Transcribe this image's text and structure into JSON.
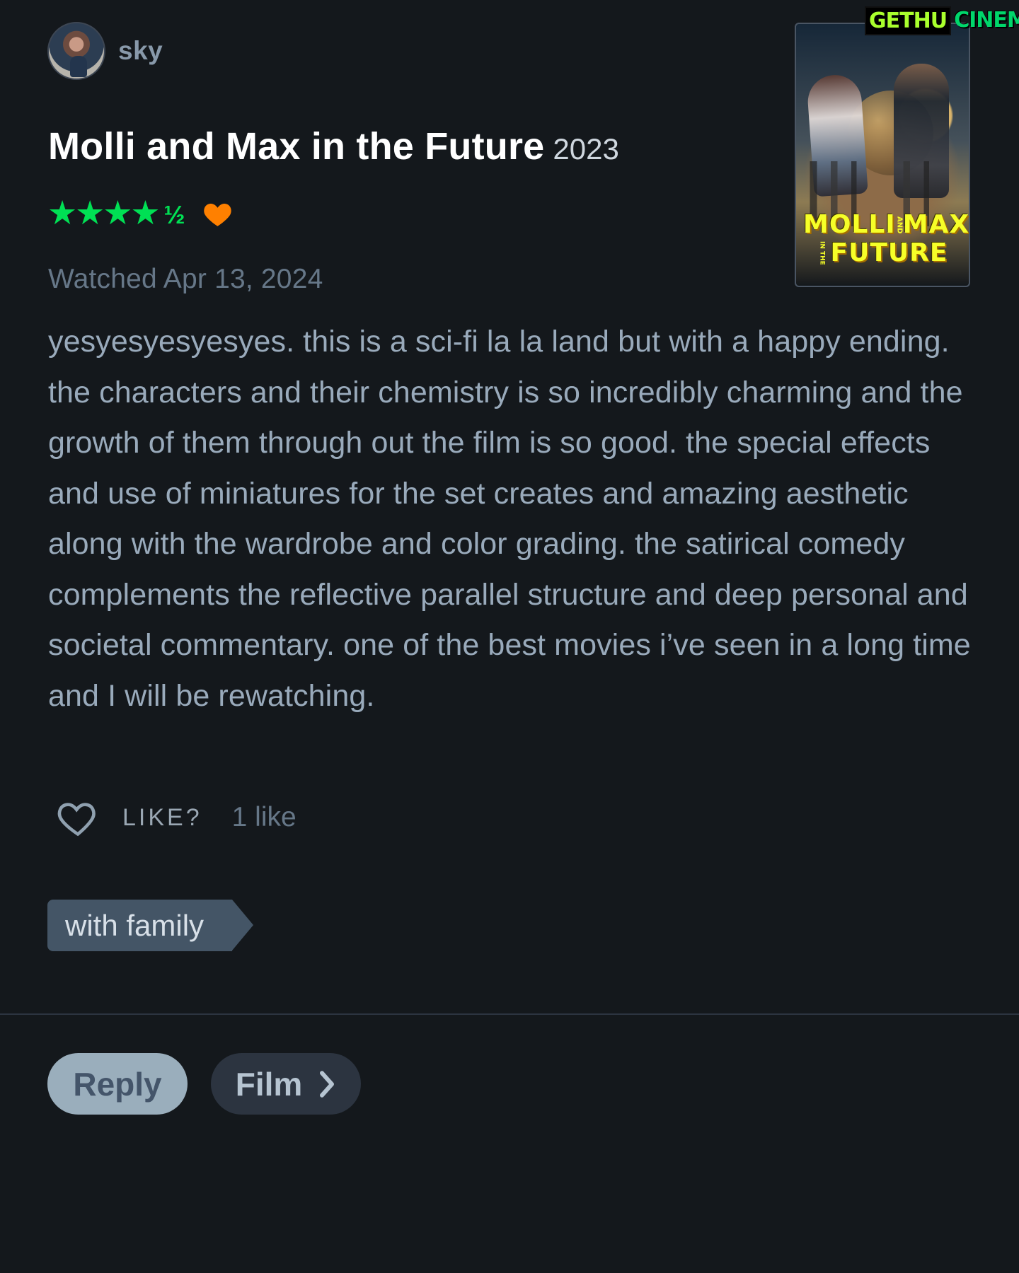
{
  "user": {
    "name": "sky"
  },
  "film": {
    "title": "Molli and Max in the Future",
    "year": "2023",
    "rating_stars": "★★★★",
    "rating_half": "½",
    "rating_value": 4.5,
    "liked": true
  },
  "watched": {
    "text": "Watched Apr 13, 2024"
  },
  "poster": {
    "title_line1_left": "MOLLI",
    "title_line1_small": "AND",
    "title_line1_right": "MAX",
    "title_line2_small": "IN THE",
    "title_line2_main": "FUTURE"
  },
  "watermark": {
    "left": "GETHU",
    "right": "CINEMA"
  },
  "review": {
    "text": "yesyesyesyesyes. this is a sci-fi la la land but with a happy ending. the characters and their chemistry is so incredibly charming and the growth of them through out the film is so good. the special effects and use of miniatures for the set creates and amazing aesthetic along with the wardrobe and color grading. the satirical comedy complements the reflective parallel structure and deep personal and societal commentary. one of the best movies i’ve seen in a long time and I will be rewatching."
  },
  "actions": {
    "like_label": "LIKE?",
    "like_count": "1 like",
    "tag": "with family",
    "reply": "Reply",
    "film": "Film"
  },
  "colors": {
    "background": "#14181c",
    "accent_green": "#00e054",
    "accent_orange": "#ff8000",
    "text_muted": "#667788",
    "text_body": "#99aabb"
  },
  "icons": {
    "liked_heart": "heart-icon",
    "like_outline": "heart-outline-icon",
    "film_chevron": "chevron-right-icon"
  }
}
